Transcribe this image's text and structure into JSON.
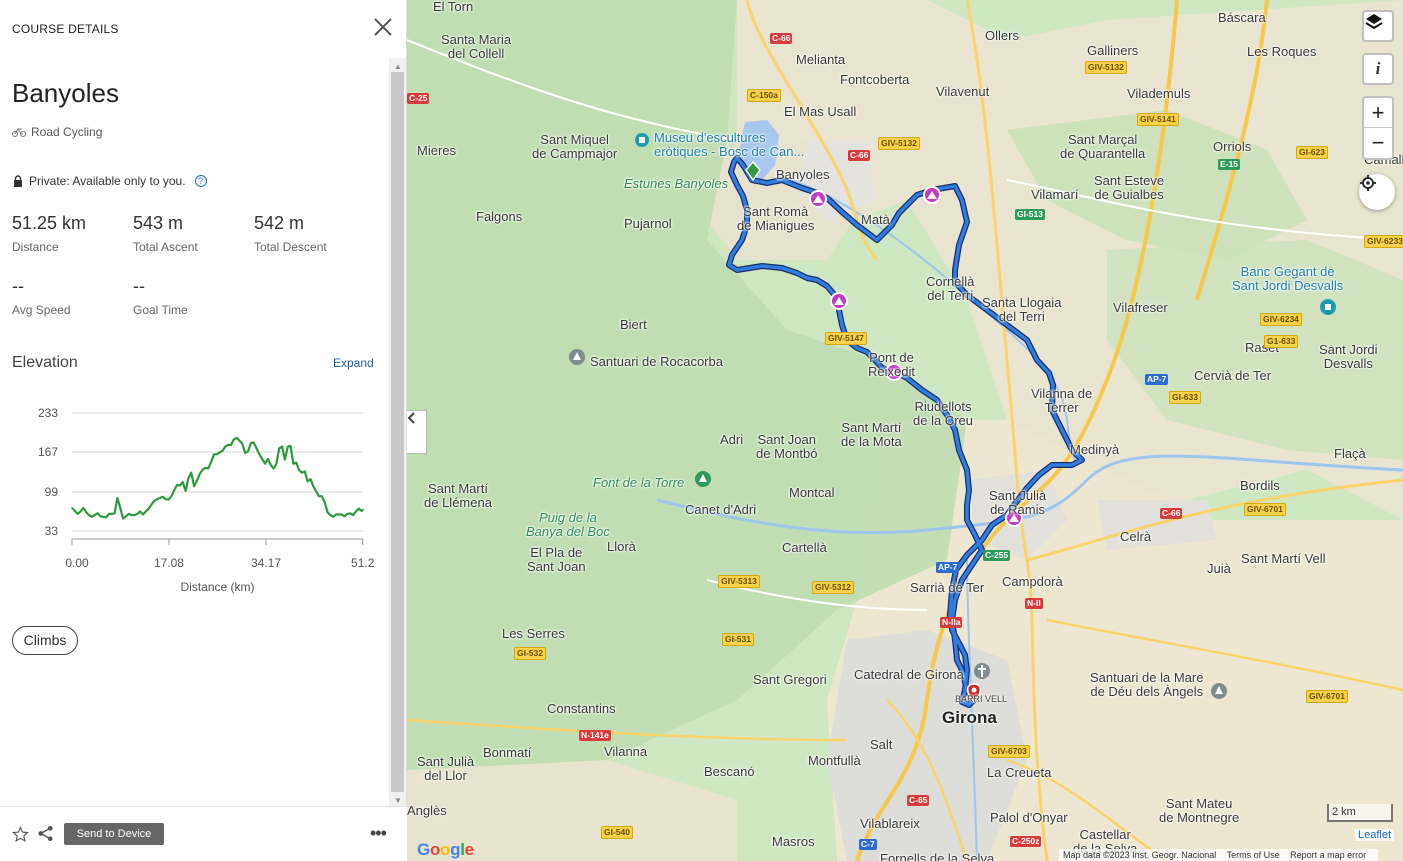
{
  "panel": {
    "header": "COURSE DETAILS",
    "course_name": "Banyoles",
    "activity": "Road Cycling",
    "privacy": "Private: Available only to you.",
    "stats": [
      {
        "value": "51.25 km",
        "label": "Distance"
      },
      {
        "value": "543 m",
        "label": "Total Ascent"
      },
      {
        "value": "542 m",
        "label": "Total Descent"
      },
      {
        "value": "--",
        "label": "Avg Speed"
      },
      {
        "value": "--",
        "label": "Goal Time"
      }
    ],
    "elevation_title": "Elevation",
    "expand_label": "Expand",
    "climbs_label": "Climbs",
    "send_label": "Send to Device",
    "more_label": "•••"
  },
  "chart_data": {
    "type": "line",
    "xlabel": "Distance (km)",
    "ylabel": "",
    "x_ticks": [
      "0.00",
      "17.08",
      "34.17",
      "51.2"
    ],
    "y_ticks": [
      "233",
      "167",
      "99",
      "33"
    ],
    "xlim": [
      0,
      51.25
    ],
    "ylim": [
      33,
      233
    ],
    "grid": true,
    "color": "#2e9a3e",
    "x": [
      0.0,
      0.5,
      1.0,
      1.5,
      2.0,
      2.5,
      3.0,
      3.5,
      4.0,
      4.5,
      5.0,
      5.5,
      6.0,
      6.5,
      7.0,
      7.5,
      8.0,
      8.5,
      9.0,
      9.5,
      10.0,
      10.5,
      11.0,
      11.5,
      12.0,
      12.5,
      13.0,
      13.5,
      14.0,
      14.5,
      15.0,
      15.5,
      16.0,
      16.5,
      17.0,
      17.5,
      18.0,
      18.5,
      19.0,
      19.5,
      20.0,
      20.5,
      21.0,
      21.5,
      22.0,
      22.5,
      23.0,
      23.5,
      24.0,
      24.5,
      25.0,
      25.5,
      26.0,
      26.5,
      27.0,
      27.5,
      28.0,
      28.5,
      29.0,
      29.5,
      30.0,
      30.5,
      31.0,
      31.5,
      32.0,
      32.5,
      33.0,
      33.5,
      34.0,
      34.5,
      35.0,
      35.5,
      36.0,
      36.5,
      37.0,
      37.5,
      38.0,
      38.5,
      39.0,
      39.5,
      40.0,
      40.5,
      41.0,
      41.5,
      42.0,
      42.5,
      43.0,
      43.5,
      44.0,
      44.5,
      45.0,
      45.5,
      46.0,
      46.5,
      47.0,
      47.5,
      48.0,
      48.5,
      49.0,
      49.5,
      50.0,
      50.5,
      51.0,
      51.25
    ],
    "y": [
      72,
      67,
      62,
      66,
      72,
      65,
      60,
      57,
      60,
      63,
      58,
      57,
      56,
      62,
      62,
      63,
      89,
      72,
      54,
      58,
      62,
      60,
      60,
      62,
      66,
      61,
      66,
      71,
      78,
      84,
      87,
      89,
      91,
      87,
      86,
      92,
      102,
      111,
      110,
      116,
      101,
      122,
      132,
      109,
      118,
      130,
      137,
      140,
      139,
      150,
      163,
      163,
      166,
      169,
      176,
      179,
      179,
      188,
      191,
      186,
      181,
      165,
      168,
      182,
      183,
      173,
      163,
      155,
      147,
      155,
      145,
      139,
      147,
      173,
      176,
      154,
      176,
      177,
      147,
      149,
      136,
      132,
      134,
      117,
      121,
      109,
      100,
      92,
      92,
      82,
      65,
      60,
      57,
      61,
      61,
      61,
      58,
      62,
      63,
      60,
      66,
      71,
      67,
      69
    ]
  },
  "map": {
    "labels": {
      "el_torn": "El Torn",
      "santa_maria_collell": "Santa Maria\ndel Collell",
      "melianta": "Melianta",
      "ollers": "Ollers",
      "bascara": "Báscara",
      "galliners": "Galliners",
      "les_roques": "Les Roques",
      "fontcoberta": "Fontcoberta",
      "vilavenut": "Vilavenut",
      "vilademuls": "Vilademuls",
      "el_mas_usall": "El Mas Usall",
      "sant_miquel": "Sant Miquel\nde Campmajor",
      "museu": "Museu d'escultures\neròtiques - Bosc de Can...",
      "mieres": "Mieres",
      "sant_marcal": "Sant Marçal\nde Quarantella",
      "orriols": "Orriols",
      "camallera": "Camaller",
      "banyoles": "Banyoles",
      "estunes": "Estunes Banyoles",
      "sant_esteve": "Sant Esteve\nde Guialbes",
      "vilamari": "Vilamarí",
      "falgons": "Falgons",
      "sant_roma": "Sant Romà\nde Mianigues",
      "mata": "Matà",
      "pujarnol": "Pujarnol",
      "cornella": "Cornellà\ndel Terri",
      "santa_llogaia": "Santa Llogaia\ndel Terri",
      "banc_gegant": "Banc Gegant de\nSant Jordi Desvalls",
      "vilafreser": "Vilafreser",
      "biert": "Biert",
      "santuari_roca": "Santuari de Rocacorba",
      "raset": "Raset",
      "sant_jordi_desvalls": "Sant Jordi\nDesvalls",
      "cervia": "Cervià de Ter",
      "pont_reixedit": "Pont de\nReixedit",
      "vilanna_t": "Vilanna de\nTerrer",
      "medinya": "Medinyà",
      "riudellots": "Riudellots\nde la Creu",
      "sant_marti_mota": "Sant Martí\nde la Mota",
      "adri": "Adri",
      "sant_joan_montbo": "Sant Joan\nde Montbó",
      "flaca": "Flaçà",
      "font_torre": "Font de la Torre",
      "montcal": "Montcal",
      "sant_marti_llemena": "Sant Martí\nde Llémena",
      "sant_julia_ramis": "Sant Julià\nde Ramis",
      "bordils": "Bordils",
      "canet": "Canet d'Adri",
      "puig_boc": "Puig de la\nBanya del Boc",
      "llora": "Llorà",
      "cartella": "Cartellà",
      "celra": "Celrà",
      "el_pla": "El Pla de\nSant Joan",
      "juia": "Juià",
      "sant_marti_vell": "Sant Martí Vell",
      "sarria": "Sarrià de Ter",
      "campdora": "Campdorà",
      "les_serres": "Les Serres",
      "catedral": "Catedral de Girona",
      "barri_vell": "BARRI VELL",
      "sant_gregori": "Sant Gregori",
      "santuari_mare": "Santuari de la Mare\nde Déu dels Àngels",
      "girona": "Girona",
      "constantins": "Constantins",
      "salt": "Salt",
      "sant_julia_llor": "Sant Julià\ndel Llor",
      "bonmati": "Bonmatí",
      "vilanna": "Vilanna",
      "montfulla": "Montfullà",
      "la_creueta": "La Creueta",
      "bescano": "Bescanó",
      "angles": "Anglès",
      "vilablareix": "Vilablareix",
      "palol": "Palol d'Onyar",
      "sant_mateu": "Sant Mateu\nde Montnegre",
      "masros": "Masros",
      "castellar": "Castellar\nde la Selva",
      "fornells": "Fornells de la Selva"
    },
    "roads": [
      "C-66",
      "C-150a",
      "GIV-5132",
      "GIV-5141",
      "GIV-5132",
      "GI-623",
      "E-15",
      "C-66",
      "GI-513",
      "GIV-6233",
      "GIV-6234",
      "G1-633",
      "AP-7",
      "GI-633",
      "GIV-5147",
      "GIV-6701",
      "C-66",
      "C-255",
      "AP-7",
      "GIV-5313",
      "GIV-5312",
      "N-II",
      "N-IIa",
      "GI-531",
      "GI-532",
      "N-141e",
      "GIV-6703",
      "GIV-6701",
      "C-65",
      "GI-540",
      "C-250z",
      "C-25",
      "C-7"
    ],
    "scale_label": "2 km",
    "leaflet_label": "Leaflet",
    "attribution": [
      "Map data ©2023 Inst. Geogr. Nacional",
      "Terms of Use",
      "Report a map error"
    ],
    "google": "Google",
    "colors": {
      "route": "#1f6ad1",
      "marker": "#c23bc8",
      "pin": "#d62828"
    }
  }
}
